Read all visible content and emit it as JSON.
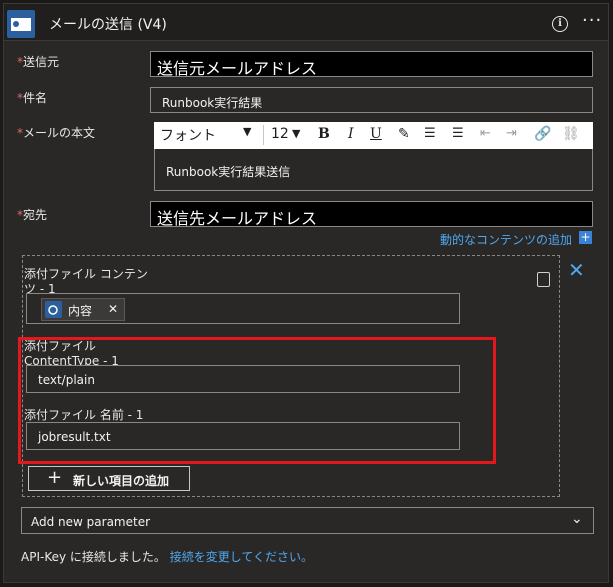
{
  "header": {
    "title": "メールの送信 (V4)",
    "app_icon": "outlook-app-icon"
  },
  "fields": {
    "from": {
      "label": "送信元",
      "value": "送信元メールアドレス"
    },
    "subject": {
      "label": "件名",
      "value": "Runbook実行結果"
    },
    "body": {
      "label": "メールの本文",
      "font": "フォント",
      "size": "12",
      "value": "Runbook実行結果送信"
    },
    "to": {
      "label": "宛先",
      "value": "送信先メールアドレス"
    }
  },
  "dynamic_content_link": "動的なコンテンツの追加",
  "attachment": {
    "content_label_line1": "添付ファイル コンテン",
    "content_label_line2": "ツ - 1",
    "chip_label": "内容",
    "content_type_label_line1": "添付ファイル",
    "content_type_label_line2": "ContentType - 1",
    "content_type_value": "text/plain",
    "name_label": "添付ファイル 名前 - 1",
    "name_value": "jobresult.txt"
  },
  "add_item_label": "新しい項目の追加",
  "add_parameter_label": "Add new parameter",
  "footer": {
    "status_text": "API-Key に接続しました。",
    "change_link": "接続を変更してください。"
  },
  "colors": {
    "accent": "#4fa8f0",
    "highlight": "#e3171c",
    "required": "#e06a6a"
  }
}
